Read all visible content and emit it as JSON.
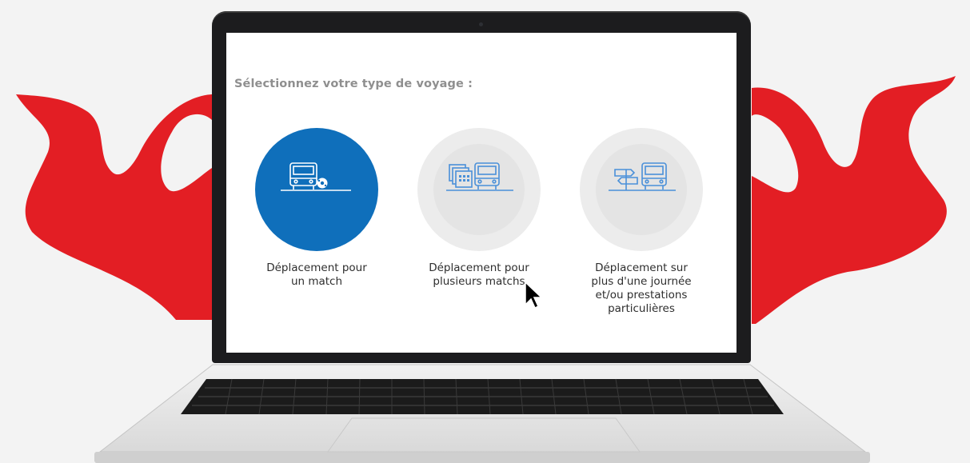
{
  "screen": {
    "title": "Sélectionnez votre type de voyage :"
  },
  "options": [
    {
      "label": "Déplacement pour un match",
      "selected": true,
      "icon": "bus-football-icon"
    },
    {
      "label": "Déplacement pour plusieurs matchs",
      "selected": false,
      "icon": "bus-calendar-icon"
    },
    {
      "label": "Déplacement sur plus d'une journée et/ou prestations particulières",
      "selected": false,
      "icon": "bus-signpost-icon"
    }
  ],
  "colors": {
    "accent": "#0f6fbb",
    "brand_red": "#e31e24",
    "icon_stroke": "#4a90d9",
    "background": "#f3f3f3"
  }
}
